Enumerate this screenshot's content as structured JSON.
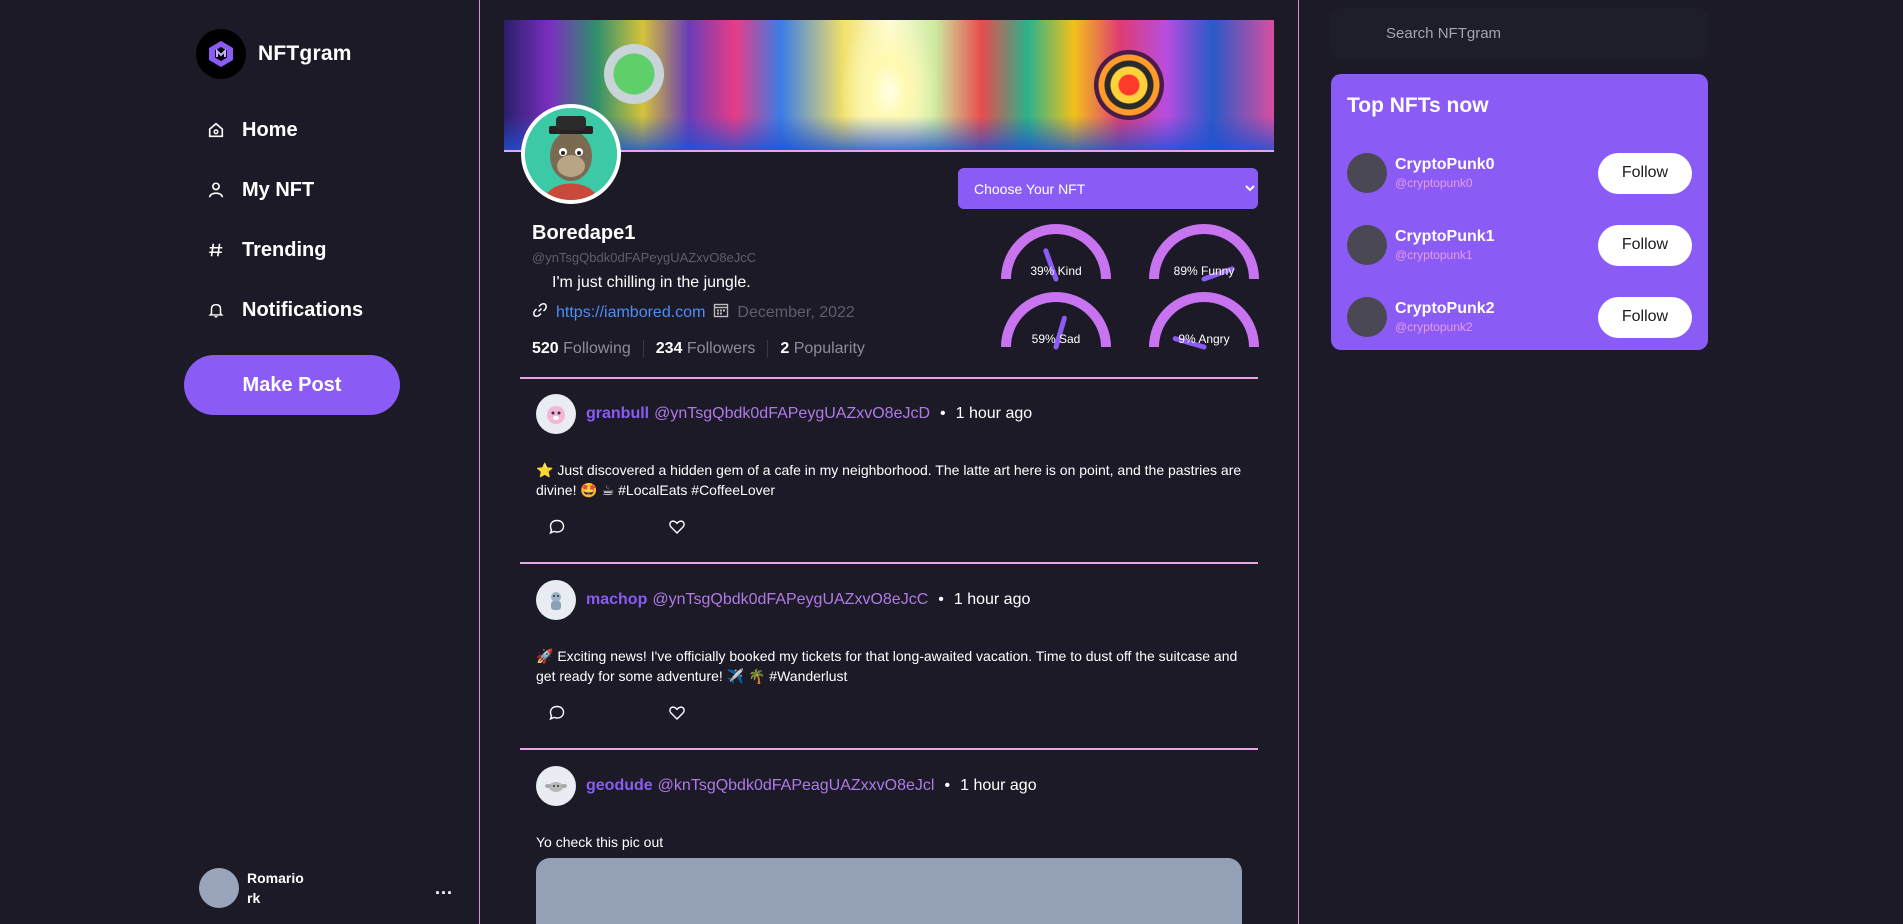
{
  "brand": {
    "name": "NFTgram"
  },
  "nav": [
    {
      "label": "Home",
      "icon": "home-icon"
    },
    {
      "label": "My NFT",
      "icon": "user-icon"
    },
    {
      "label": "Trending",
      "icon": "hash-icon"
    },
    {
      "label": "Notifications",
      "icon": "bell-icon"
    }
  ],
  "make_post_label": "Make Post",
  "account": {
    "line1": "Romario",
    "line2": "rk",
    "more": "..."
  },
  "profile": {
    "name": "Boredape1",
    "handle": "@ynTsgQbdk0dFAPeygUAZxvO8eJcC",
    "bio": "I'm just chilling in the jungle.",
    "link": "https://iambored.com",
    "joined": "December, 2022",
    "following_count": "520",
    "following_label": "Following",
    "followers_count": "234",
    "followers_label": "Followers",
    "popularity_count": "2",
    "popularity_label": "Popularity",
    "select_placeholder": "Choose Your NFT"
  },
  "moods": [
    {
      "label": "39% Kind",
      "value": 0.39
    },
    {
      "label": "89% Funny",
      "value": 0.89
    },
    {
      "label": "59% Sad",
      "value": 0.59
    },
    {
      "label": "9% Angry",
      "value": 0.09
    }
  ],
  "posts": [
    {
      "user": "granbull",
      "handle": "@ynTsgQbdk0dFAPeygUAZxvO8eJcD",
      "time": "1 hour ago",
      "text": "⭐ Just discovered a hidden gem of a cafe in my neighborhood. The latte art here is on point, and the pastries are divine! 🤩 ☕ #LocalEats #CoffeeLover"
    },
    {
      "user": "machop",
      "handle": "@ynTsgQbdk0dFAPeygUAZxvO8eJcC",
      "time": "1 hour ago",
      "text": "🚀 Exciting news! I've officially booked my tickets for that long-awaited vacation. Time to dust off the suitcase and get ready for some adventure! ✈️ 🌴 #Wanderlust"
    },
    {
      "user": "geodude",
      "handle": "@knTsgQbdk0dFAPeagUAZxxvO8eJcl",
      "time": "1 hour ago",
      "text": "Yo check this pic out"
    }
  ],
  "search": {
    "placeholder": "Search NFTgram"
  },
  "top_nfts": {
    "title": "Top NFTs now",
    "items": [
      {
        "name": "CryptoPunk0",
        "handle": "@cryptopunk0",
        "follow": "Follow"
      },
      {
        "name": "CryptoPunk1",
        "handle": "@cryptopunk1",
        "follow": "Follow"
      },
      {
        "name": "CryptoPunk2",
        "handle": "@cryptopunk2",
        "follow": "Follow"
      }
    ]
  },
  "colors": {
    "accent": "#8a5cf5",
    "pink": "#e7a4e6",
    "background": "#1b1a26",
    "gauge": "#c873f0"
  }
}
